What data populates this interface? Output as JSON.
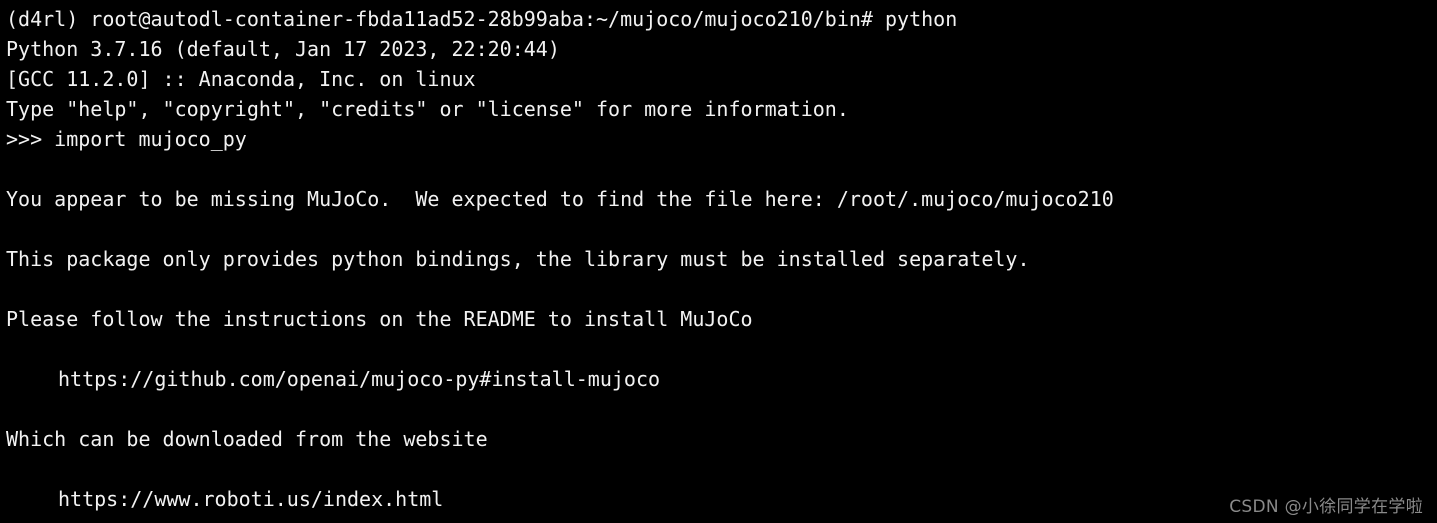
{
  "terminal": {
    "background_color": "#000000",
    "text_color": "#f2f2f2",
    "watermark_color": "#8a8a8a",
    "lines": [
      {
        "id": "prompt-line",
        "text": "(d4rl) root@autodl-container-fbda11ad52-28b99aba:~/mujoco/mujoco210/bin# python",
        "indent": false
      },
      {
        "id": "python-version",
        "text": "Python 3.7.16 (default, Jan 17 2023, 22:20:44)",
        "indent": false
      },
      {
        "id": "gcc-banner",
        "text": "[GCC 11.2.0] :: Anaconda, Inc. on linux",
        "indent": false
      },
      {
        "id": "help-banner",
        "text": "Type \"help\", \"copyright\", \"credits\" or \"license\" for more information.",
        "indent": false
      },
      {
        "id": "import-statement",
        "text": ">>> import mujoco_py",
        "indent": false
      },
      {
        "id": "spacer-1",
        "text": "",
        "indent": false
      },
      {
        "id": "missing-mujoco",
        "text": "You appear to be missing MuJoCo.  We expected to find the file here: /root/.mujoco/mujoco210",
        "indent": false
      },
      {
        "id": "spacer-2",
        "text": "",
        "indent": false
      },
      {
        "id": "bindings-note",
        "text": "This package only provides python bindings, the library must be installed separately.",
        "indent": false
      },
      {
        "id": "spacer-3",
        "text": "",
        "indent": false
      },
      {
        "id": "readme-note",
        "text": "Please follow the instructions on the README to install MuJoCo",
        "indent": false
      },
      {
        "id": "spacer-4",
        "text": "",
        "indent": false
      },
      {
        "id": "github-url",
        "text": "https://github.com/openai/mujoco-py#install-mujoco",
        "indent": true
      },
      {
        "id": "spacer-5",
        "text": "",
        "indent": false
      },
      {
        "id": "download-note",
        "text": "Which can be downloaded from the website",
        "indent": false
      },
      {
        "id": "spacer-6",
        "text": "",
        "indent": false
      },
      {
        "id": "roboti-url",
        "text": "https://www.roboti.us/index.html",
        "indent": true
      }
    ],
    "watermark": "CSDN @小徐同学在学啦"
  }
}
